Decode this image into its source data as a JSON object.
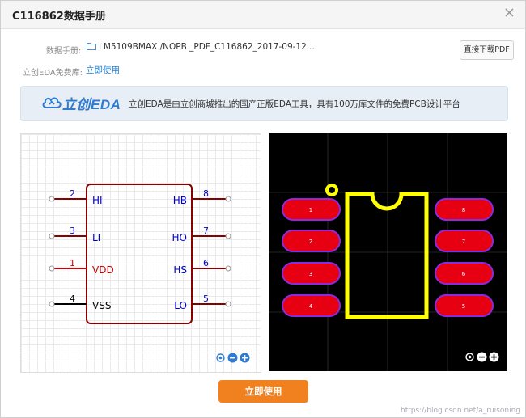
{
  "dialog": {
    "title": "C116862数据手册",
    "close_symbol": "×"
  },
  "datasheet": {
    "label": "数据手册:",
    "filename": "LM5109BMAX /NOPB _PDF_C116862_2017-09-12....",
    "download_label": "直接下载PDF"
  },
  "library": {
    "label": "立创EDA免费库:",
    "link": "立即使用"
  },
  "banner": {
    "logo_text": "立创EDA",
    "text": "立创EDA是由立创商城推出的国产正版EDA工具，具有100万库文件的免费PCB设计平台"
  },
  "schematic": {
    "pins_left": [
      {
        "number": "2",
        "name": "HI"
      },
      {
        "number": "3",
        "name": "LI"
      },
      {
        "number": "1",
        "name": "VDD"
      },
      {
        "number": "4",
        "name": "VSS"
      }
    ],
    "pins_right": [
      {
        "number": "8",
        "name": "HB"
      },
      {
        "number": "7",
        "name": "HO"
      },
      {
        "number": "6",
        "name": "HS"
      },
      {
        "number": "5",
        "name": "LO"
      }
    ]
  },
  "footprint": {
    "pads_left": [
      "1",
      "2",
      "3",
      "4"
    ],
    "pads_right": [
      "8",
      "7",
      "6",
      "5"
    ]
  },
  "footer": {
    "use_button": "立即使用",
    "watermark": "https://blog.csdn.net/a_ruisoning"
  },
  "colors": {
    "accent": "#f1801e",
    "link": "#1b7fd6",
    "pad_fill": "#e60012",
    "pad_border": "#8a2be2",
    "silkscreen": "#ffff00",
    "schematic_body": "#880000",
    "pin_name": "#0000cc",
    "power_pin": "#cc0000"
  }
}
